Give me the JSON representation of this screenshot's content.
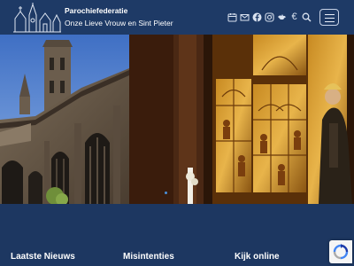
{
  "brand": {
    "line1": "Parochiefederatie",
    "line2": "Onze Lieve Vrouw en Sint Pieter"
  },
  "header_icons": [
    "calendar-icon",
    "mail-icon",
    "facebook-icon",
    "instagram-icon",
    "bird-icon",
    "euro-icon",
    "search-icon"
  ],
  "euro_glyph": "€",
  "hero": {
    "left_image": "church-tower-photo",
    "right_image": "golden-altarpiece-photo"
  },
  "footer": {
    "col1": "Laatste Nieuws",
    "col2": "Misintenties",
    "col3": "Kijk online"
  },
  "colors": {
    "header_bg": "#1e3a66",
    "page_bg": "#1d3761",
    "accent_dot": "#4a90d9"
  }
}
